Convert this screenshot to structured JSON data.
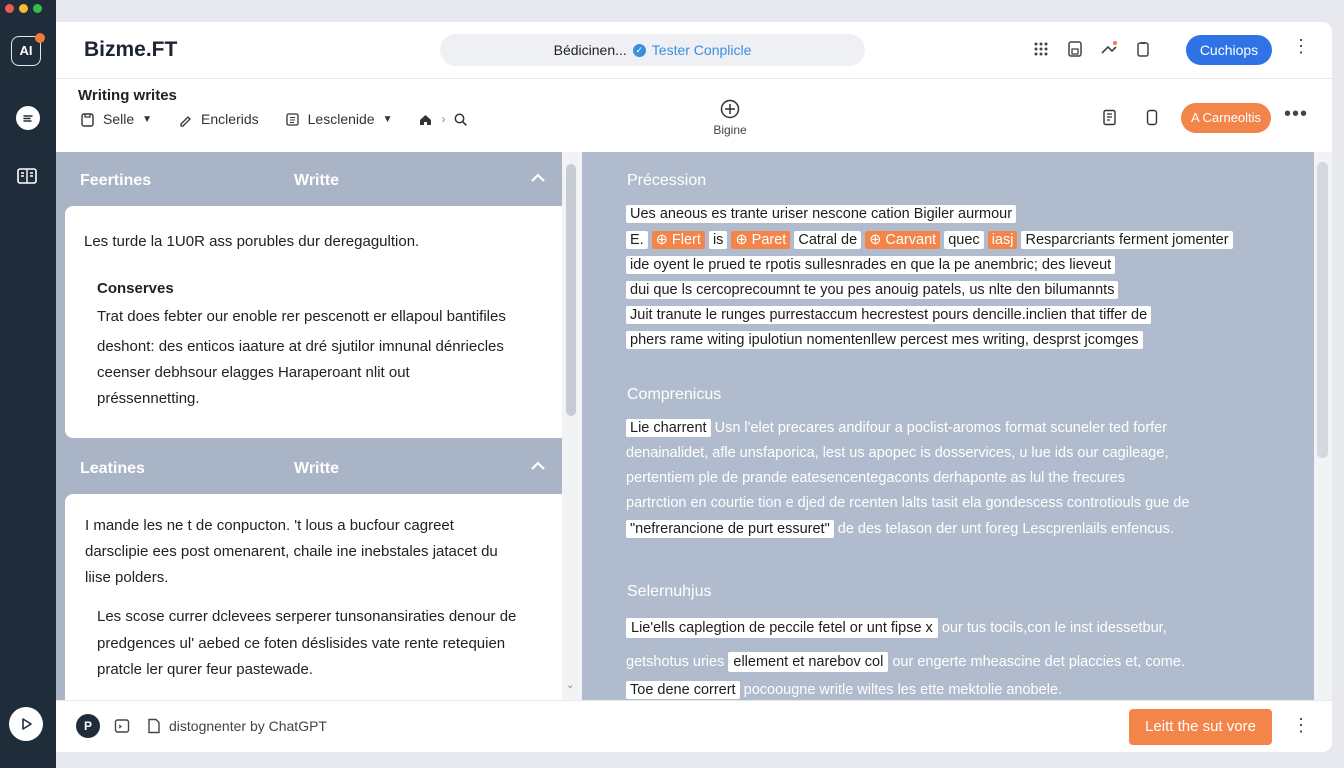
{
  "app": {
    "title": "Bizme.FT",
    "rail_logo": "AI",
    "url_text": "Bédicinen...",
    "url_link": "Tester Conplicle",
    "primary_button": "Cuchiops"
  },
  "toolbar": {
    "doc_title": "Writing writes",
    "style_label": "Selle",
    "enclerids_label": "Enclerids",
    "lesclenide_label": "Lesclenide",
    "center_label": "Bigine",
    "action_button": "A Carneoltis"
  },
  "left": {
    "section1": {
      "col1": "Feertines",
      "col2": "Writte"
    },
    "card1": {
      "intro": "Les turde la 1U0R ass porubles dur deregagultion.",
      "subtitle": "Conserves",
      "line1": "Trat does febter our enoble rer pescenott er ellapoul bantifiles",
      "line2": "deshont: des enticos iaature at dré sjutilor imnunal dénriecles",
      "line3": "ceenser debhsour elagges Haraperoant nlit out",
      "line4": "préssennetting."
    },
    "section2": {
      "col1": "Leatines",
      "col2": "Writte"
    },
    "card2": {
      "line1": "I mande les ne t de conpucton. 't lous a bucfour cagreet",
      "line2": "darsclipie ees post omenarent, chaile ine inebstales jatacet du",
      "line3": "liise polders.",
      "line4": "Les scose currer dclevees serperer tunsonansiraties denour de",
      "line5": "predgences ul' aebed ce foten déslisides vate rente retequien",
      "line6": "pratcle ler qurer feur pastewade."
    }
  },
  "right": {
    "heading1": "Précession",
    "p1": {
      "l1": "Ues aneous es trante uriser nescone cation Bigiler aurmour",
      "l2_a": "E.",
      "l2_tag1": "⊕ Flert",
      "l2_b": "is",
      "l2_tag2": "⊕ Paret",
      "l2_c": "Catral de",
      "l2_tag3": "⊕ Carvant",
      "l2_d": "quec",
      "l2_tag4": "iasj",
      "l2_e": "Resparcriants ferment jomenter",
      "l3": "ide oyent le prued te rpotis sullesnrades en que la pe anembric; des lieveut",
      "l4": "dui que ls cercoprecoumnt te you pes anouig patels, us nlte den bilumannts",
      "l5": "Juit tranute le runges purrestaccum hecrestest pours dencille.inclien that tiffer de",
      "l6": "phers rame witing ipulotiun nomentenllew percest mes writing, desprst jcomges"
    },
    "heading2": "Comprenicus",
    "p2": {
      "l1_hl": "Lie charrent",
      "l1": "Usn l'elet precares andifour a poclist-aromos format scuneler ted forfer",
      "l2": "denainalidet, afle unsfaporica, lest us apopec is dosservices, u lue ids our cagileage,",
      "l3": "pertentiem ple de prande eatesencentegaconts derhaponte as lul the frecures",
      "l4": "partrction en courtie tion e djed de rcenten lalts tasit ela gondescess controtiouls gue de",
      "l5_hl": "\"nefrerancione de purt essuret\"",
      "l5": "de des telason der unt foreg Lescprenlails enfencus."
    },
    "heading3": "Selernuhjus",
    "p3": {
      "l1_hl": "Lie'ells caplegtion de peccile fetel or unt fipse x",
      "l1": "our tus tocils,con le inst idessetbur,",
      "l2_a": "getshotus uries",
      "l2_hl": "ellement et narebov col",
      "l2_b": "our engerte mheascine det placcies et, come.",
      "l3_hl": "Toe dene corrert",
      "l3": "pocoougne writle wiltes les ette mektolie anobele."
    }
  },
  "bottom": {
    "avatar": "P",
    "text": "distognenter by ChatGPT",
    "cta": "Leitt the sut vore"
  },
  "colors": {
    "rail": "#1f2d3a",
    "accent_blue": "#2f73e6",
    "accent_orange": "#f4854a",
    "left_pane": "#a9b5c6",
    "right_pane": "#b0bccd"
  }
}
